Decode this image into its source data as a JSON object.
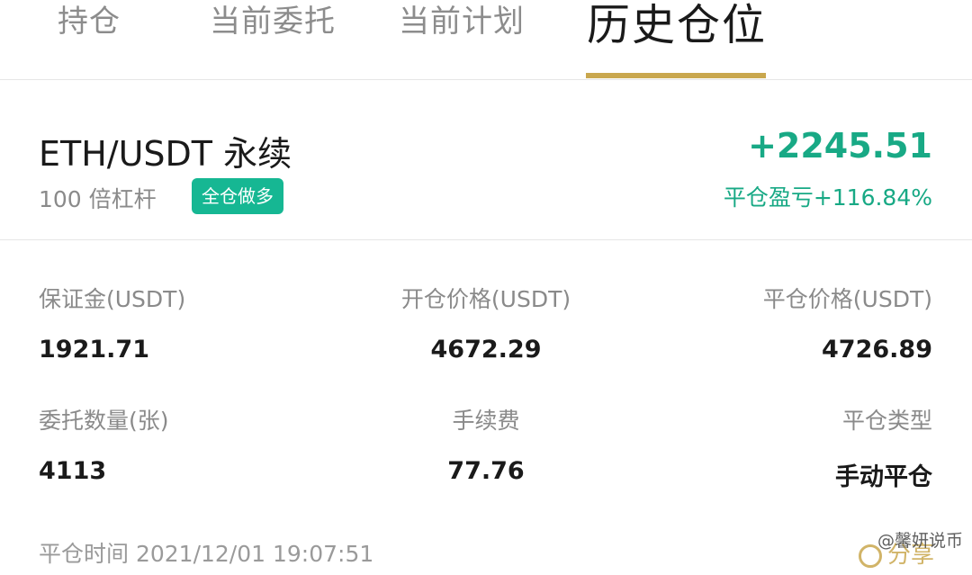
{
  "tabs": {
    "items": [
      "持仓",
      "当前委托",
      "当前计划",
      "历史仓位"
    ],
    "active": "历史仓位"
  },
  "position": {
    "pair": "ETH/USDT 永续",
    "leverage": "100 倍杠杆",
    "mode_badge": "全仓做多",
    "pnl": "+2245.51",
    "pnl_label": "平仓盈亏+116.84%"
  },
  "details": {
    "margin_label": "保证金(USDT)",
    "margin_value": "1921.71",
    "open_price_label": "开仓价格(USDT)",
    "open_price_value": "4672.29",
    "close_price_label": "平仓价格(USDT)",
    "close_price_value": "4726.89",
    "order_qty_label": "委托数量(张)",
    "order_qty_value": "4113",
    "fee_label": "手续费",
    "fee_value": "77.76",
    "close_type_label": "平仓类型",
    "close_type_value": "手动平仓"
  },
  "footer": {
    "close_time": "平仓时间 2021/12/01 19:07:51",
    "share_label": "分享",
    "share_icon": "share-icon",
    "watermark": "@馨妍说币"
  },
  "colors": {
    "accent_gold": "#c9a74e",
    "profit_green": "#18a985",
    "badge_green": "#16b793"
  }
}
